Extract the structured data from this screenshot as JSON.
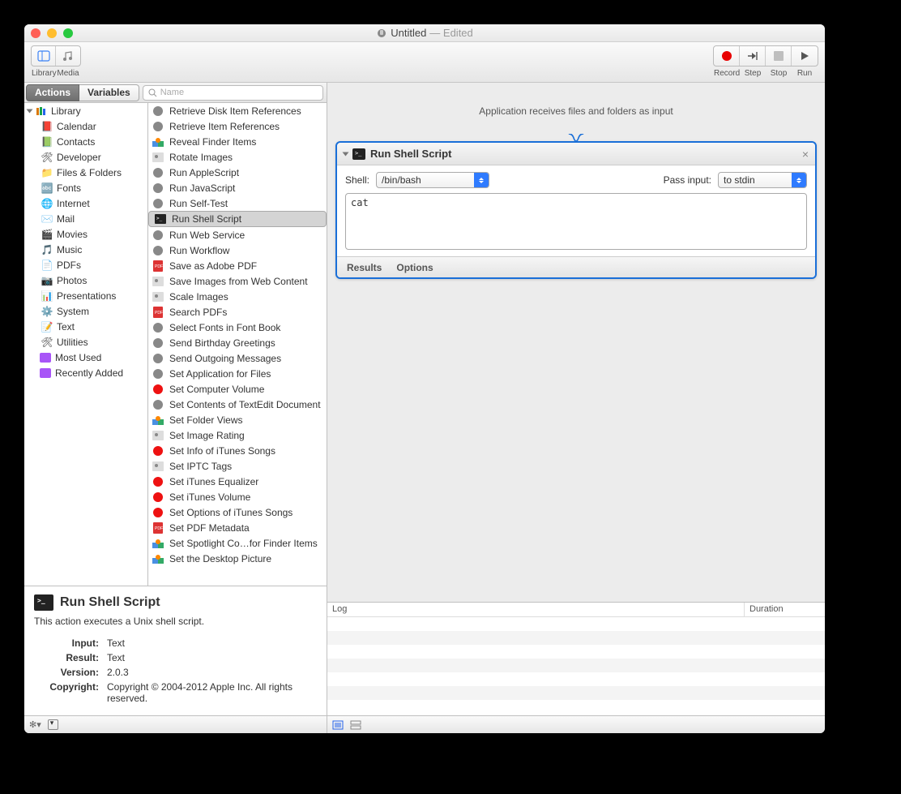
{
  "window": {
    "title": "Untitled",
    "subtitle": "— Edited"
  },
  "toolbar": {
    "library": "Library",
    "media": "Media",
    "record": "Record",
    "step": "Step",
    "stop": "Stop",
    "run": "Run"
  },
  "filter": {
    "actions": "Actions",
    "variables": "Variables",
    "search_placeholder": "Name"
  },
  "sidebar": {
    "root": "Library",
    "items": [
      "Calendar",
      "Contacts",
      "Developer",
      "Files & Folders",
      "Fonts",
      "Internet",
      "Mail",
      "Movies",
      "Music",
      "PDFs",
      "Photos",
      "Presentations",
      "System",
      "Text",
      "Utilities"
    ],
    "most_used": "Most Used",
    "recently_added": "Recently Added"
  },
  "actions": [
    "Retrieve Disk Item References",
    "Retrieve Item References",
    "Reveal Finder Items",
    "Rotate Images",
    "Run AppleScript",
    "Run JavaScript",
    "Run Self-Test",
    "Run Shell Script",
    "Run Web Service",
    "Run Workflow",
    "Save as Adobe PDF",
    "Save Images from Web Content",
    "Scale Images",
    "Search PDFs",
    "Select Fonts in Font Book",
    "Send Birthday Greetings",
    "Send Outgoing Messages",
    "Set Application for Files",
    "Set Computer Volume",
    "Set Contents of TextEdit Document",
    "Set Folder Views",
    "Set Image Rating",
    "Set Info of iTunes Songs",
    "Set IPTC Tags",
    "Set iTunes Equalizer",
    "Set iTunes Volume",
    "Set Options of iTunes Songs",
    "Set PDF Metadata",
    "Set Spotlight Co…for Finder Items",
    "Set the Desktop Picture"
  ],
  "action_selected_index": 7,
  "info": {
    "title": "Run Shell Script",
    "desc": "This action executes a Unix shell script.",
    "input_label": "Input:",
    "input": "Text",
    "result_label": "Result:",
    "result": "Text",
    "version_label": "Version:",
    "version": "2.0.3",
    "copyright_label": "Copyright:",
    "copyright": "Copyright © 2004-2012 Apple Inc.  All rights reserved."
  },
  "workflow": {
    "hint": "Application receives files and folders as input",
    "action": {
      "title": "Run Shell Script",
      "shell_label": "Shell:",
      "shell_value": "/bin/bash",
      "pass_label": "Pass input:",
      "pass_value": "to stdin",
      "code": "cat",
      "results": "Results",
      "options": "Options"
    }
  },
  "log": {
    "col_log": "Log",
    "col_duration": "Duration"
  }
}
